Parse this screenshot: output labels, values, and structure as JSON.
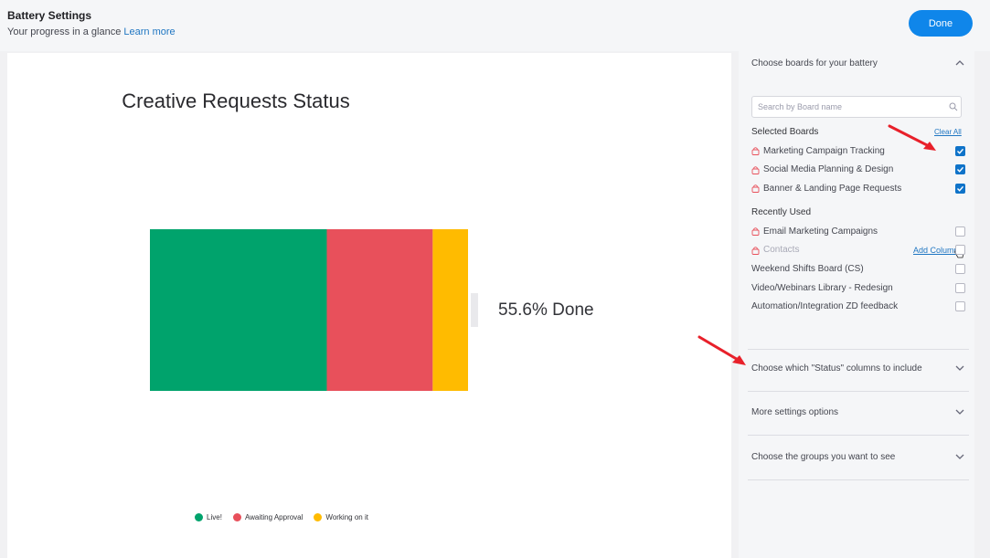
{
  "header": {
    "title": "Battery Settings",
    "subtitle": "Your progress in a glance",
    "learn_more": "Learn more",
    "done_label": "Done"
  },
  "chart_data": {
    "type": "bar",
    "title": "Creative Requests Status",
    "orientation": "horizontal-stacked",
    "categories": [
      "Live!",
      "Awaiting Approval",
      "Working on it"
    ],
    "series": [
      {
        "name": "Live!",
        "values": [
          55.6
        ],
        "color": "#00a36c"
      },
      {
        "name": "Awaiting Approval",
        "values": [
          33.3
        ],
        "color": "#e8505b"
      },
      {
        "name": "Working on it",
        "values": [
          11.1
        ],
        "color": "#ffbb00"
      }
    ],
    "annotation": "55.6% Done",
    "legend_position": "bottom"
  },
  "sidebar": {
    "boards_section": "Choose boards for your battery",
    "search_placeholder": "Search by Board name",
    "selected_label": "Selected Boards",
    "clear_all": "Clear All",
    "selected": [
      {
        "label": "Marketing Campaign Tracking",
        "checked": true
      },
      {
        "label": "Social Media Planning & Design",
        "checked": true
      },
      {
        "label": "Banner & Landing Page Requests",
        "checked": true
      }
    ],
    "recent_label": "Recently Used",
    "recent": [
      {
        "label": "Email Marketing Campaigns",
        "checked": false
      },
      {
        "label": "Contacts",
        "checked": false
      },
      {
        "label": "Weekend Shifts Board (CS)",
        "checked": false
      },
      {
        "label": "Video/Webinars Library - Redesign",
        "checked": false
      },
      {
        "label": "Automation/Integration ZD feedback",
        "checked": false
      }
    ],
    "add_column": "Add Column",
    "status_section": "Choose which \"Status\" columns to include",
    "more_section": "More settings options",
    "groups_section": "Choose the groups you want to see"
  },
  "colors": {
    "accent": "#0f86ea",
    "link": "#1f76c2",
    "arrow": "#e8202a"
  }
}
